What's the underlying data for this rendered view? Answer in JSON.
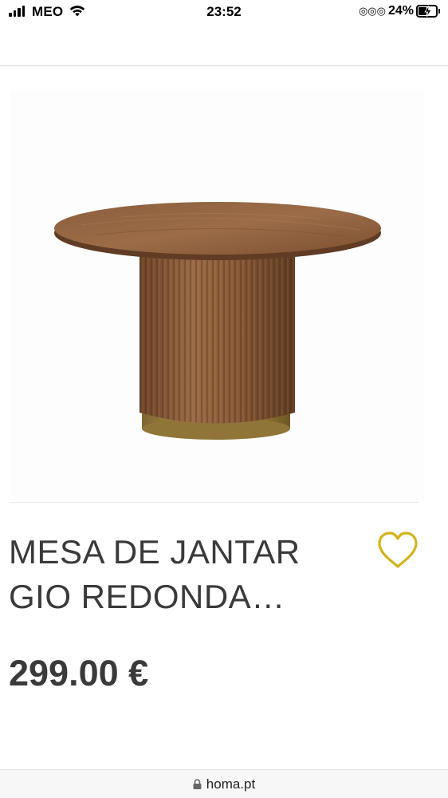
{
  "status_bar": {
    "carrier": "MEO",
    "time": "23:52",
    "rings": "◎◎◎",
    "battery_percent": "24%"
  },
  "product": {
    "title_line1": "MESA DE JANTAR",
    "title_line2": "GIO REDONDA…",
    "price": "299.00 €",
    "favorite_color": "#d4b21c"
  },
  "browser": {
    "url": "homa.pt"
  }
}
